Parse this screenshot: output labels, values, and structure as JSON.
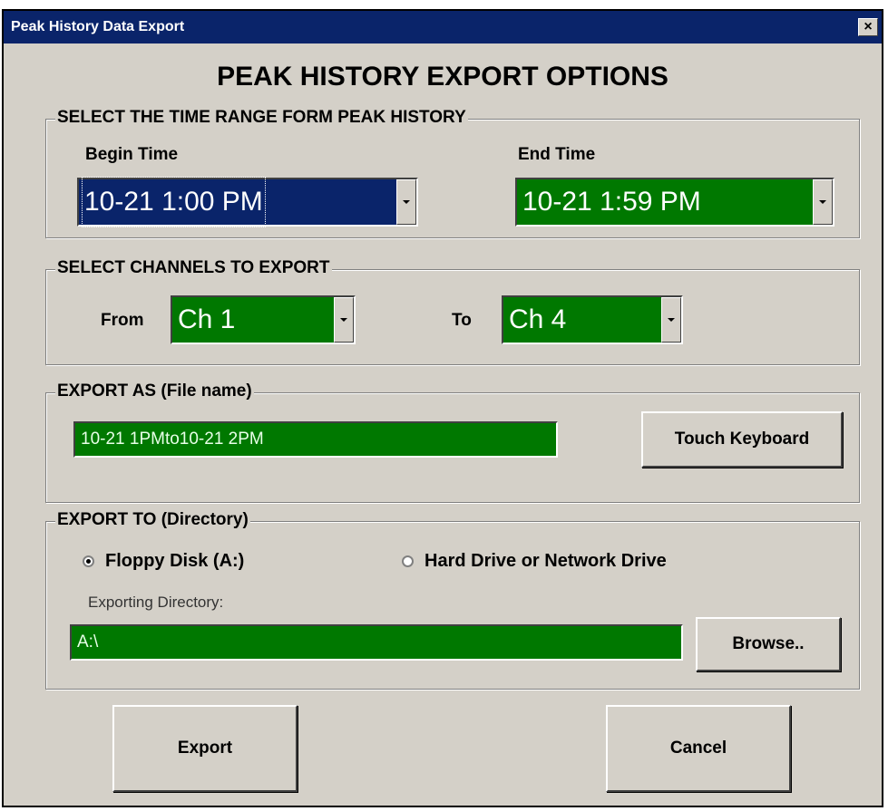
{
  "window": {
    "title": "Peak History Data Export",
    "close_label": "×"
  },
  "heading": "PEAK HISTORY EXPORT OPTIONS",
  "time_range": {
    "group_label": "SELECT THE TIME RANGE FORM PEAK HISTORY",
    "begin_label": "Begin Time",
    "begin_value": "10-21 1:00 PM",
    "end_label": "End Time",
    "end_value": "10-21 1:59 PM"
  },
  "channels": {
    "group_label": "SELECT CHANNELS TO EXPORT",
    "from_label": "From",
    "from_value": "Ch 1",
    "to_label": "To",
    "to_value": "Ch 4"
  },
  "export_as": {
    "group_label": "EXPORT AS (File name)",
    "file_name": "10-21 1PMto10-21 2PM",
    "keyboard_button": "Touch Keyboard"
  },
  "export_to": {
    "group_label": "EXPORT TO (Directory)",
    "options": [
      {
        "label": "Floppy Disk (A:)",
        "selected": true
      },
      {
        "label": "Hard Drive or Network Drive",
        "selected": false
      }
    ],
    "directory_label": "Exporting Directory:",
    "directory_value": "A:\\",
    "browse_button": "Browse.."
  },
  "actions": {
    "export": "Export",
    "cancel": "Cancel"
  },
  "colors": {
    "field_green": "#007800",
    "title_blue": "#0a246a",
    "dialog_gray": "#d4d0c8"
  },
  "icons": {
    "close": "close-icon",
    "dropdown": "chevron-down-icon",
    "radio": "radio-icon"
  }
}
